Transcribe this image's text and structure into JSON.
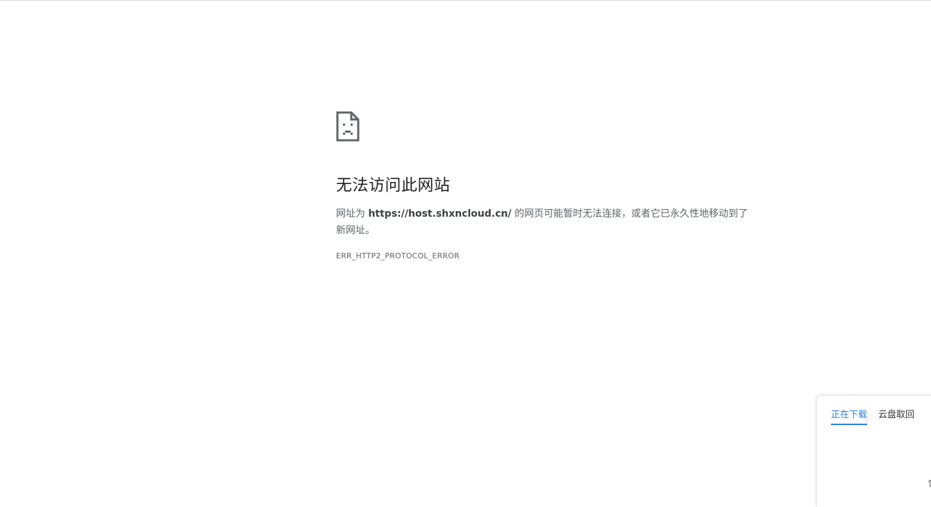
{
  "error": {
    "icon": "sad-page-icon",
    "title": "无法访问此网站",
    "message_prefix": "网址为 ",
    "url": "https://host.shxncloud.cn/",
    "message_suffix": " 的网页可能暂时无法连接，或者它已永久性地移动到了新网址。",
    "code": "ERR_HTTP2_PROTOCOL_ERROR"
  },
  "download_panel": {
    "tabs": [
      {
        "label": "正在下载",
        "active": true
      },
      {
        "label": "云盘取回",
        "active": false
      }
    ],
    "corner_glyph": "警"
  },
  "colors": {
    "accent": "#2b7de9",
    "text_secondary": "#5f6368",
    "title": "#202124"
  }
}
